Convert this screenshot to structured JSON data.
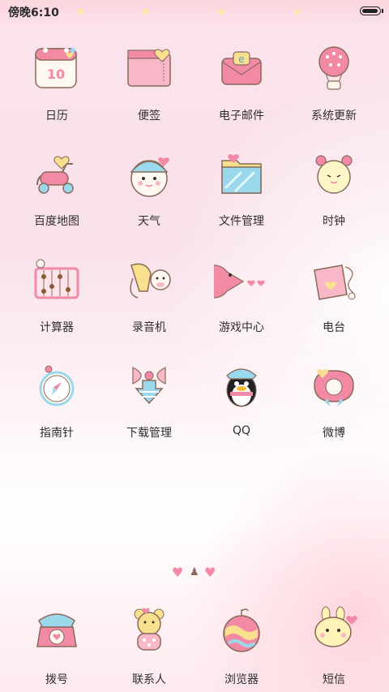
{
  "status_bar": {
    "time": "傍晚6:10"
  },
  "apps": [
    {
      "label": "日历",
      "icon": "calendar-icon"
    },
    {
      "label": "便签",
      "icon": "notes-icon"
    },
    {
      "label": "电子邮件",
      "icon": "email-icon"
    },
    {
      "label": "系统更新",
      "icon": "hot-air-balloon-icon"
    },
    {
      "label": "百度地图",
      "icon": "scooter-icon"
    },
    {
      "label": "天气",
      "icon": "snowman-icon"
    },
    {
      "label": "文件管理",
      "icon": "folder-icon"
    },
    {
      "label": "时钟",
      "icon": "alarm-clock-icon"
    },
    {
      "label": "计算器",
      "icon": "abacus-icon"
    },
    {
      "label": "录音机",
      "icon": "giraffe-microphone-icon"
    },
    {
      "label": "游戏中心",
      "icon": "pacman-icon"
    },
    {
      "label": "电台",
      "icon": "radio-icon"
    },
    {
      "label": "指南针",
      "icon": "compass-icon"
    },
    {
      "label": "下载管理",
      "icon": "download-bow-icon"
    },
    {
      "label": "QQ",
      "icon": "penguin-icon"
    },
    {
      "label": "微博",
      "icon": "weibo-flower-icon"
    }
  ],
  "dock": [
    {
      "label": "拨号",
      "icon": "telephone-icon"
    },
    {
      "label": "联系人",
      "icon": "bear-icon"
    },
    {
      "label": "浏览器",
      "icon": "globe-icon"
    },
    {
      "label": "短信",
      "icon": "bunny-message-icon"
    }
  ],
  "colors": {
    "pink": "#f28aa6",
    "light_pink": "#f9c5d3",
    "yellow": "#f8e08e",
    "blue": "#9ad8ec",
    "cream": "#fff6ea",
    "outline": "#8a6a5a"
  }
}
